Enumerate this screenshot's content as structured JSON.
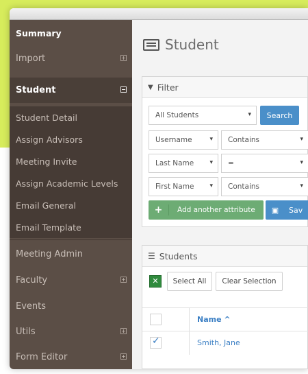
{
  "sidebar": {
    "summary": "Summary",
    "import": "Import",
    "student": "Student",
    "student_sub": [
      "Student Detail",
      "Assign Advisors",
      "Meeting Invite",
      "Assign Academic Levels",
      "Email General",
      "Email Template"
    ],
    "meeting_admin": "Meeting Admin",
    "faculty": "Faculty",
    "events": "Events",
    "utils": "Utils",
    "form_editor": "Form Editor"
  },
  "main": {
    "title": "Student",
    "filter": {
      "heading": "Filter",
      "students_select": "All Students",
      "search_button": "Search",
      "rows": [
        {
          "field": "Username",
          "operator": "Contains"
        },
        {
          "field": "Last Name",
          "operator": "="
        },
        {
          "field": "First Name",
          "operator": "Contains"
        }
      ],
      "add_attribute": "Add another attribute",
      "save": "Sav"
    },
    "students": {
      "heading": "Students",
      "select_all": "Select All",
      "clear_selection": "Clear Selection",
      "column_name": "Name ^",
      "rows": [
        {
          "name": "Smith, Jane",
          "checked": true
        }
      ]
    }
  },
  "colors": {
    "background": "#d7ec5c",
    "sidebar": "#5b4e46",
    "primary": "#4a8fc9",
    "success": "#6dac74",
    "link": "#3b7fc4"
  }
}
